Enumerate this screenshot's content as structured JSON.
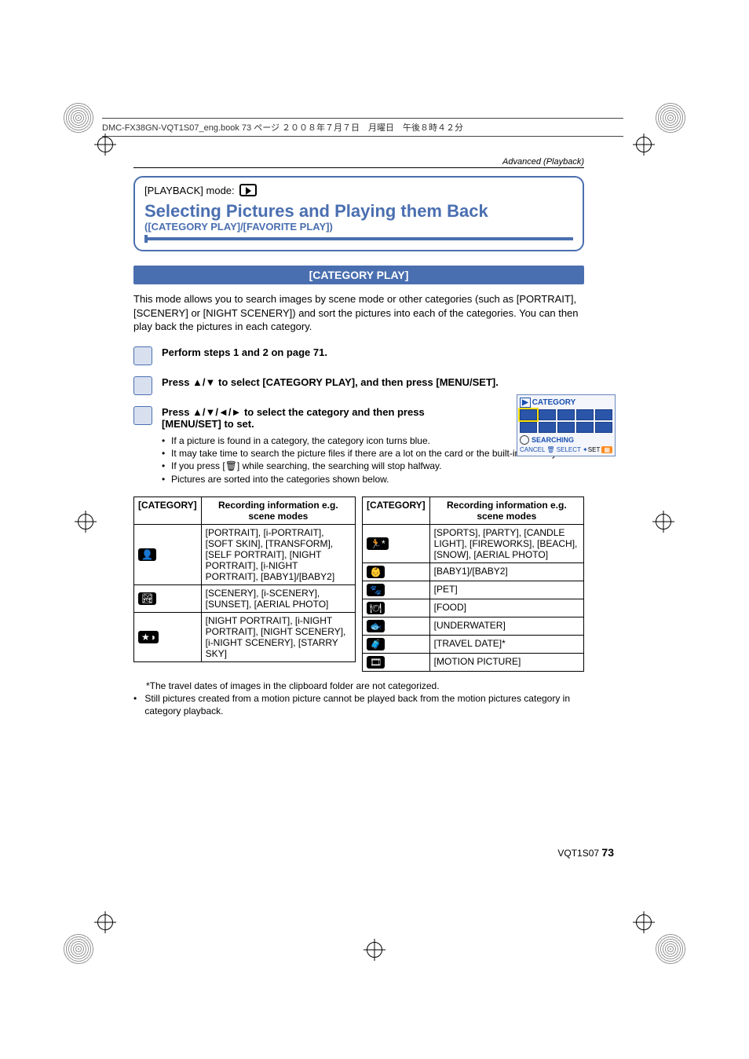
{
  "header_line": "DMC-FX38GN-VQT1S07_eng.book  73 ページ  ２００８年７月７日　月曜日　午後８時４２分",
  "breadcrumb": "Advanced (Playback)",
  "mode_label": "[PLAYBACK] mode:",
  "title_main": "Selecting Pictures and Playing them Back",
  "title_sub": "([CATEGORY PLAY]/[FAVORITE PLAY])",
  "section_bar": "[CATEGORY PLAY]",
  "intro": "This mode allows you to search images by scene mode or other categories (such as [PORTRAIT], [SCENERY] or [NIGHT SCENERY]) and sort the pictures into each of the categories. You can then play back the pictures in each category.",
  "step1": "Perform steps 1 and 2 on page 71.",
  "step2": "Press ▲/▼ to select [CATEGORY PLAY], and then press [MENU/SET].",
  "step3_title": "Press ▲/▼/◄/► to select the category and then press [MENU/SET] to set.",
  "step3_notes": [
    "If a picture is found in a category, the category icon turns blue.",
    "It may take time to search the picture files if there are a lot on the card or the built-in memory.",
    "If you press [🗑] while searching, the searching will stop halfway.",
    "Pictures are sorted into the categories shown below."
  ],
  "table_header_cat": "[CATEGORY]",
  "table_header_info": "Recording information e.g. scene modes",
  "left_table": [
    {
      "icon": "👤",
      "text": "[PORTRAIT], [i-PORTRAIT], [SOFT SKIN], [TRANSFORM], [SELF PORTRAIT], [NIGHT PORTRAIT], [i-NIGHT PORTRAIT], [BABY1]/[BABY2]"
    },
    {
      "icon": "🏞",
      "text": "[SCENERY], [i-SCENERY], [SUNSET], [AERIAL PHOTO]"
    },
    {
      "icon": "★◑",
      "text": "[NIGHT PORTRAIT], [i-NIGHT PORTRAIT], [NIGHT SCENERY], [i-NIGHT SCENERY], [STARRY SKY]"
    }
  ],
  "right_table": [
    {
      "icon": "🏃*",
      "text": "[SPORTS], [PARTY], [CANDLE LIGHT], [FIREWORKS], [BEACH], [SNOW], [AERIAL PHOTO]"
    },
    {
      "icon": "👶",
      "text": "[BABY1]/[BABY2]"
    },
    {
      "icon": "🐾",
      "text": "[PET]"
    },
    {
      "icon": "🍽",
      "text": "[FOOD]"
    },
    {
      "icon": "🐟",
      "text": "[UNDERWATER]"
    },
    {
      "icon": "🧳",
      "text": "[TRAVEL DATE]*"
    },
    {
      "icon": "🎞",
      "text": "[MOTION PICTURE]"
    }
  ],
  "footnote1": "*The travel dates of images in the clipboard folder are not categorized.",
  "footnote2": "Still pictures created from a motion picture cannot be played back from the motion pictures category in category playback.",
  "osd": {
    "title": "CATEGORY",
    "searching": "SEARCHING",
    "cancel": "CANCEL",
    "select": "SELECT",
    "set": "SET"
  },
  "doc_code": "VQT1S07",
  "page_number": "73"
}
